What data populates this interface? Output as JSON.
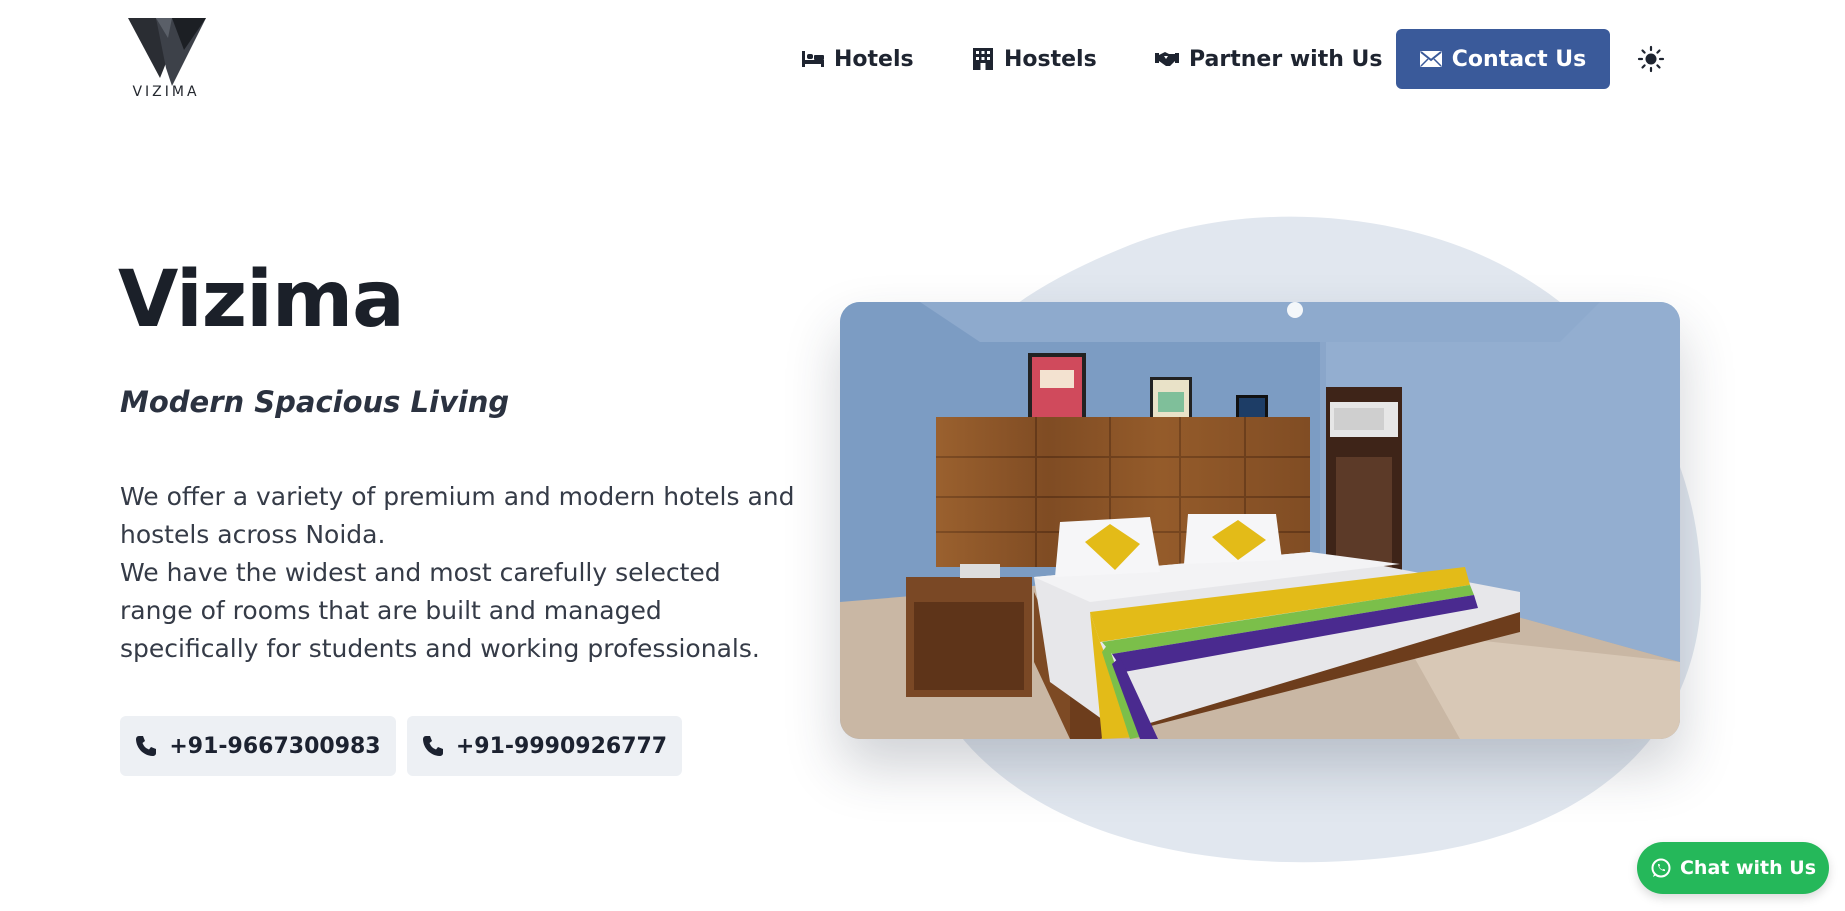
{
  "brand": {
    "logo_text": "VIZIMA"
  },
  "nav": {
    "hotels": "Hotels",
    "hostels": "Hostels",
    "partner": "Partner with Us",
    "contact": "Contact Us"
  },
  "hero": {
    "title": "Vizima",
    "subtitle": "Modern Spacious Living",
    "desc_line1": "We offer a variety of premium and modern hotels and hostels across Noida.",
    "desc_line2": "We have the widest and most carefully selected range of rooms that are built and managed specifically for students and working professionals.",
    "phones": [
      "+91-9667300983",
      "+91-9990926777"
    ]
  },
  "chat": {
    "label": "Chat with Us"
  },
  "colors": {
    "accent": "#3a5a9a",
    "chat_green": "#25b85a",
    "button_bg": "#edf0f4",
    "blob": "#e1e7ef"
  }
}
